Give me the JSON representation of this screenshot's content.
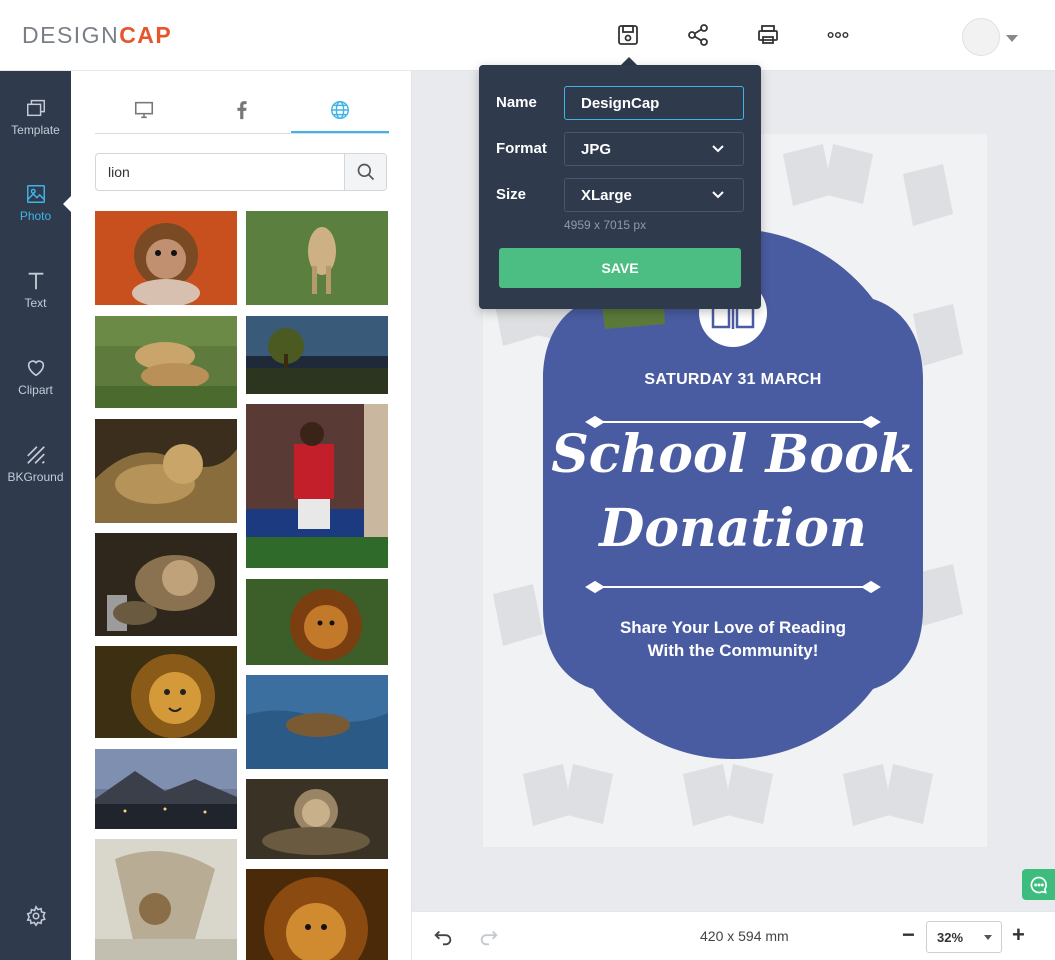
{
  "app": {
    "logo_part1": "DESIGN",
    "logo_part2": "CAP",
    "accent_color": "#3fb4e6",
    "brand_color": "#e8552b",
    "sidebar_color": "#2f3a4d",
    "save_color": "#4cbd83"
  },
  "toolbar": {
    "icons": [
      "save-icon",
      "share-icon",
      "print-icon",
      "more-icon"
    ]
  },
  "sidebar": {
    "items": [
      {
        "label": "Template",
        "icon": "template-icon"
      },
      {
        "label": "Photo",
        "icon": "photo-icon",
        "active": true
      },
      {
        "label": "Text",
        "icon": "text-icon"
      },
      {
        "label": "Clipart",
        "icon": "heart-icon"
      },
      {
        "label": "BKGround",
        "icon": "background-icon"
      }
    ],
    "settings_icon": "gear-icon"
  },
  "photo_panel": {
    "tabs": [
      "desktop-icon",
      "facebook-icon",
      "globe-icon"
    ],
    "active_tab": 2,
    "search_value": "lion",
    "search_icon": "search-icon"
  },
  "save_dialog": {
    "name_label": "Name",
    "name_value": "DesignCap",
    "format_label": "Format",
    "format_value": "JPG",
    "size_label": "Size",
    "size_value": "XLarge",
    "size_hint": "4959 x 7015 px",
    "save_label": "SAVE"
  },
  "poster": {
    "date": "SATURDAY 31 MARCH",
    "title_line1": "School Book",
    "title_line2": "Donation",
    "subtitle_line1": "Share Your Love of Reading",
    "subtitle_line2": "With the Community!",
    "badge_color": "#4a5ca1"
  },
  "bottom_bar": {
    "page_size": "420 x 594 mm",
    "zoom_value": "32%",
    "zoom_minus": "−",
    "zoom_plus": "+"
  }
}
